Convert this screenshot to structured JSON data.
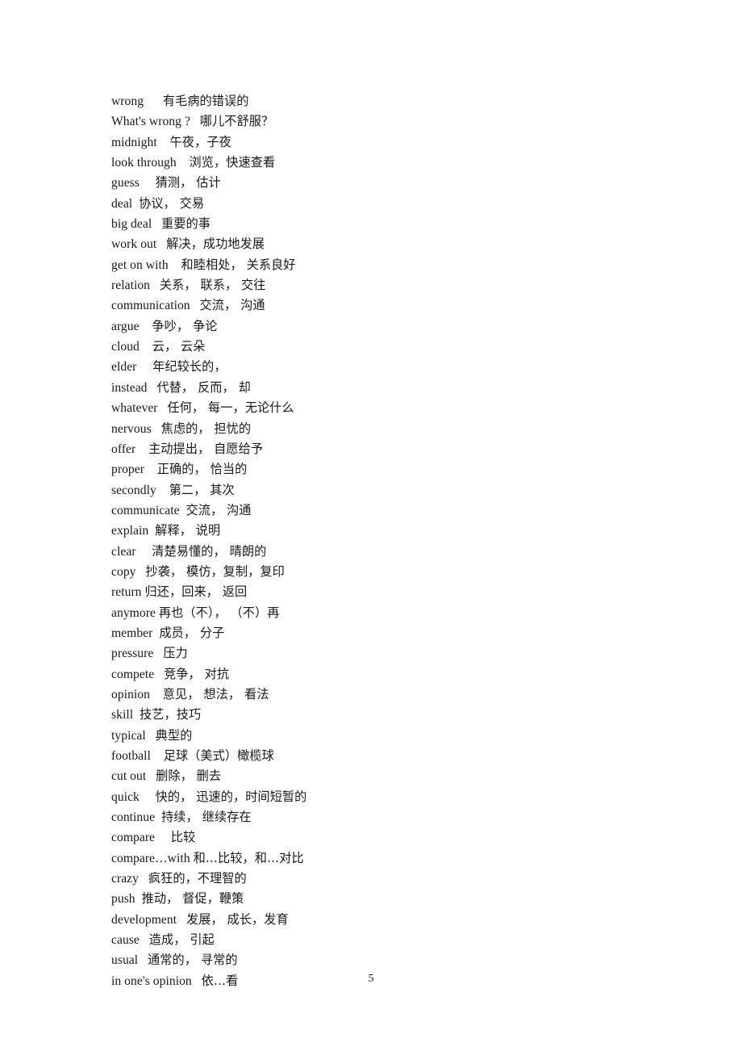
{
  "document": {
    "page_number": "5",
    "entries": [
      {
        "term": "wrong",
        "sep": "      ",
        "gloss": "有毛病的错误的"
      },
      {
        "term": "What's wrong ?",
        "sep": "   ",
        "gloss": "哪儿不舒服？"
      },
      {
        "term": "midnight",
        "sep": "    ",
        "gloss": "午夜，子夜"
      },
      {
        "term": "look through",
        "sep": "    ",
        "gloss": "浏览，快速查看"
      },
      {
        "term": "guess",
        "sep": "     ",
        "gloss": "猜测， 估计"
      },
      {
        "term": "deal",
        "sep": "  ",
        "gloss": "协议， 交易"
      },
      {
        "term": "big deal",
        "sep": "   ",
        "gloss": "重要的事"
      },
      {
        "term": "work out",
        "sep": "   ",
        "gloss": "解决，成功地发展"
      },
      {
        "term": "get on with",
        "sep": "    ",
        "gloss": "和睦相处， 关系良好"
      },
      {
        "term": "relation",
        "sep": "   ",
        "gloss": "关系， 联系， 交往"
      },
      {
        "term": "communication",
        "sep": "   ",
        "gloss": "交流， 沟通"
      },
      {
        "term": "argue",
        "sep": "    ",
        "gloss": "争吵， 争论"
      },
      {
        "term": "cloud",
        "sep": "    ",
        "gloss": "云， 云朵"
      },
      {
        "term": "elder",
        "sep": "     ",
        "gloss": "年纪较长的，"
      },
      {
        "term": "instead",
        "sep": "   ",
        "gloss": "代替， 反而， 却"
      },
      {
        "term": "whatever",
        "sep": "   ",
        "gloss": "任何， 每一，无论什么"
      },
      {
        "term": "nervous",
        "sep": "   ",
        "gloss": "焦虑的， 担忧的"
      },
      {
        "term": "offer",
        "sep": "    ",
        "gloss": "主动提出， 自愿给予"
      },
      {
        "term": "proper",
        "sep": "    ",
        "gloss": "正确的， 恰当的"
      },
      {
        "term": "secondly",
        "sep": "    ",
        "gloss": "第二， 其次"
      },
      {
        "term": "communicate",
        "sep": "  ",
        "gloss": "交流， 沟通"
      },
      {
        "term": "explain",
        "sep": "  ",
        "gloss": "解释， 说明"
      },
      {
        "term": "clear",
        "sep": "     ",
        "gloss": "清楚易懂的， 晴朗的"
      },
      {
        "term": "copy",
        "sep": "   ",
        "gloss": "抄袭， 模仿，复制，复印"
      },
      {
        "term": "return",
        "sep": " ",
        "gloss": "归还，回来， 返回"
      },
      {
        "term": "anymore",
        "sep": " ",
        "gloss": "再也（不）， （不）再"
      },
      {
        "term": "member",
        "sep": "  ",
        "gloss": "成员， 分子"
      },
      {
        "term": "pressure",
        "sep": "   ",
        "gloss": "压力"
      },
      {
        "term": "compete",
        "sep": "   ",
        "gloss": "竞争， 对抗"
      },
      {
        "term": "opinion",
        "sep": "    ",
        "gloss": "意见， 想法， 看法"
      },
      {
        "term": "skill",
        "sep": "  ",
        "gloss": "技艺，技巧"
      },
      {
        "term": "typical",
        "sep": "   ",
        "gloss": "典型的"
      },
      {
        "term": "football",
        "sep": "    ",
        "gloss": "足球（美式）橄榄球"
      },
      {
        "term": "cut out",
        "sep": "   ",
        "gloss": "删除， 删去"
      },
      {
        "term": "quick",
        "sep": "     ",
        "gloss": "快的， 迅速的，时间短暂的"
      },
      {
        "term": "continue",
        "sep": "  ",
        "gloss": "持续， 继续存在"
      },
      {
        "term": "compare",
        "sep": "     ",
        "gloss": "比较"
      },
      {
        "term": "compare…with",
        "sep": " ",
        "gloss": "和…比较，和…对比"
      },
      {
        "term": "crazy",
        "sep": "   ",
        "gloss": "疯狂的，不理智的"
      },
      {
        "term": "push",
        "sep": "  ",
        "gloss": "推动， 督促，鞭策"
      },
      {
        "term": "development",
        "sep": "   ",
        "gloss": "发展， 成长，发育"
      },
      {
        "term": "cause",
        "sep": "   ",
        "gloss": "造成， 引起"
      },
      {
        "term": "usual",
        "sep": "   ",
        "gloss": "通常的， 寻常的"
      },
      {
        "term": "in one's opinion",
        "sep": "   ",
        "gloss": "依…看"
      }
    ]
  }
}
